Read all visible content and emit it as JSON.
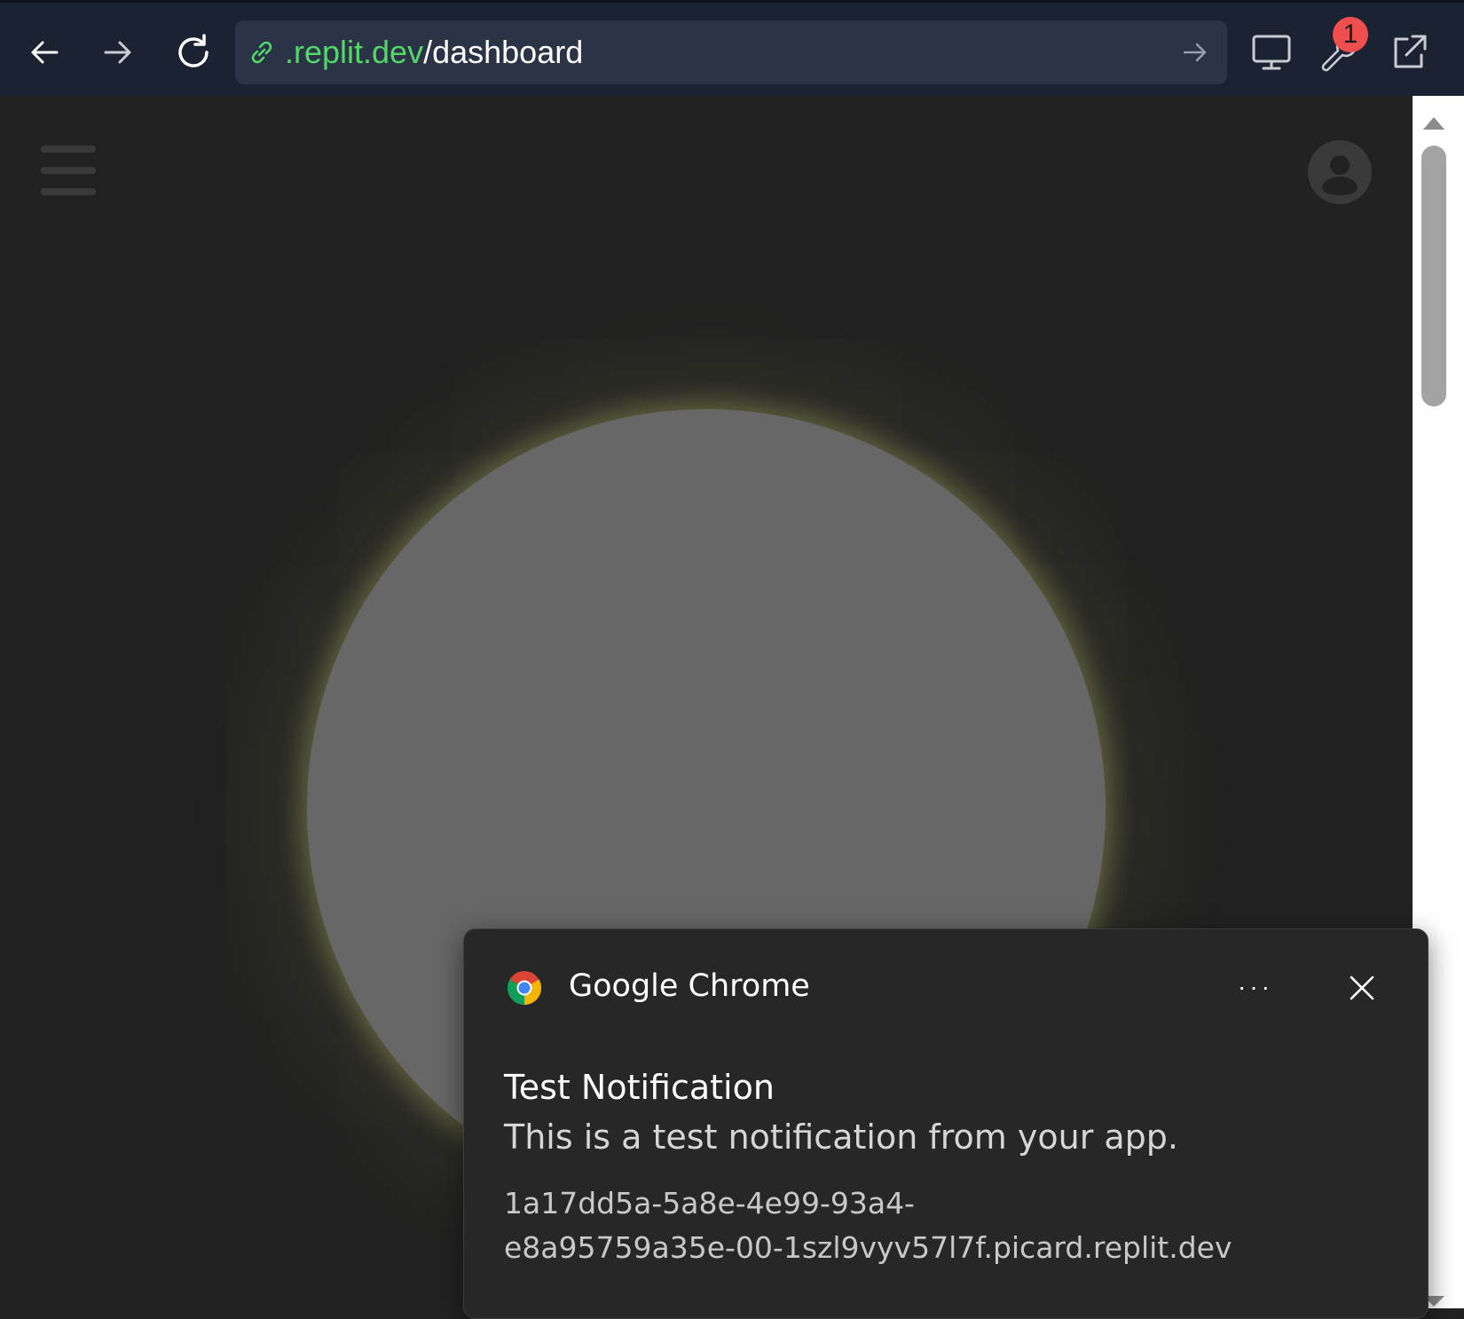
{
  "browser": {
    "url_host": ".replit.dev",
    "url_path": "/dashboard",
    "devtools_badge_count": "1",
    "icons": [
      "back-arrow-icon",
      "forward-arrow-icon",
      "reload-icon",
      "link-icon",
      "go-arrow-icon",
      "monitor-icon",
      "wrench-icon",
      "open-in-new-tab-icon"
    ]
  },
  "page": {
    "icons": [
      "hamburger-menu-icon",
      "user-avatar-icon"
    ],
    "orb_color": "#676767"
  },
  "notification": {
    "app_name": "Google Chrome",
    "more_label": "···",
    "title": "Test Notification",
    "body": "This is a test notification from your app.",
    "origin_line1": "1a17dd5a-5a8e-4e99-93a4-",
    "origin_line2": "e8a95759a35e-00-1szl9vyv57l7f.picard.replit.dev"
  },
  "colors": {
    "toolbar_bg": "#1b2232",
    "url_host_green": "#54d66a",
    "badge_red": "#ef4e4e",
    "page_bg": "#222222"
  }
}
